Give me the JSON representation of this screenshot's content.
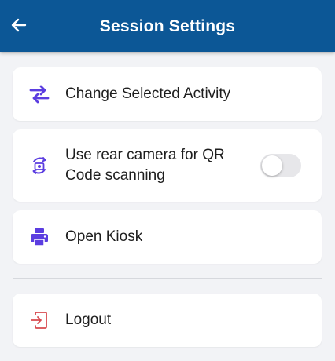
{
  "header": {
    "title": "Session Settings",
    "back_icon": "arrow-left-icon"
  },
  "colors": {
    "appbar": "#0c5796",
    "accent": "#5b3de0",
    "danger": "#d84a4f",
    "background": "#f2f3f6"
  },
  "items": [
    {
      "label": "Change Selected Activity",
      "icon": "swap-arrows-icon"
    },
    {
      "label": "Use rear camera for QR Code scanning",
      "icon": "camera-switch-icon",
      "toggle_on": false
    },
    {
      "label": "Open Kiosk",
      "icon": "printer-icon"
    }
  ],
  "logout": {
    "label": "Logout",
    "icon": "logout-icon"
  }
}
